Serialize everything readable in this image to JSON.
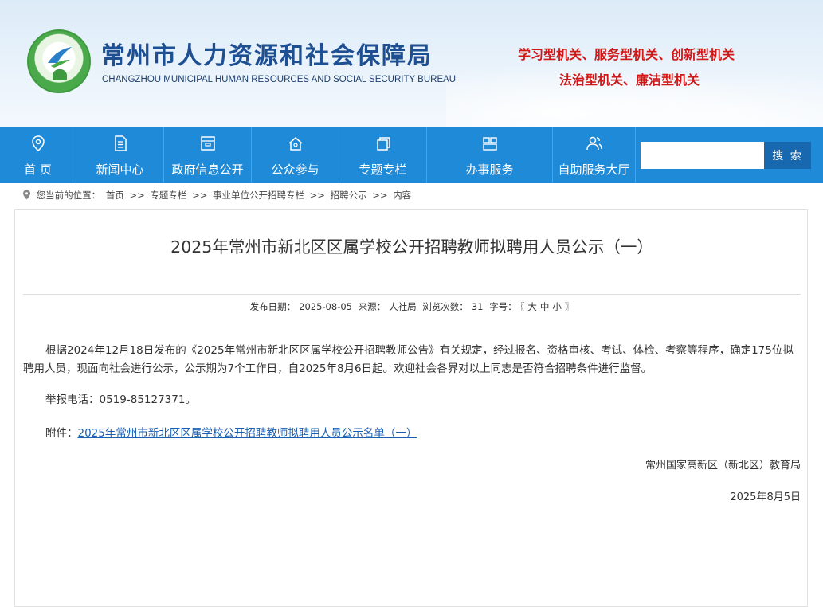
{
  "header": {
    "title_cn": "常州市人力资源和社会保障局",
    "title_en": "CHANGZHOU MUNICIPAL HUMAN RESOURCES AND SOCIAL SECURITY BUREAU",
    "slogan_line1": "学习型机关、服务型机关、创新型机关",
    "slogan_line2": "法治型机关、廉洁型机关",
    "logo_icon": "bureau-logo-icon",
    "slogan_color": "#d01818",
    "title_color": "#1d4f92"
  },
  "nav": {
    "bg_color": "#1f8ad8",
    "items": [
      {
        "label": "首 页",
        "icon": "location-pin-icon"
      },
      {
        "label": "新闻中心",
        "icon": "document-icon"
      },
      {
        "label": "政府信息公开",
        "icon": "archive-box-icon"
      },
      {
        "label": "公众参与",
        "icon": "people-home-icon"
      },
      {
        "label": "专题专栏",
        "icon": "stacked-pages-icon"
      },
      {
        "label": "办事服务",
        "icon": "service-icon"
      },
      {
        "label": "自助服务大厅",
        "icon": "users-icon"
      }
    ],
    "search_placeholder": "",
    "search_button": "搜 索"
  },
  "breadcrumb": {
    "prefix": "您当前的位置：",
    "items": [
      "首页",
      ">>",
      "专题专栏",
      ">>",
      "事业单位公开招聘专栏",
      ">>",
      "招聘公示",
      ">>",
      "内容"
    ]
  },
  "article": {
    "title": "2025年常州市新北区区属学校公开招聘教师拟聘用人员公示（一）",
    "meta": {
      "date_label": "发布日期：",
      "date": "2025-08-05",
      "source_label": "来源：",
      "source": "人社局",
      "views_label": "浏览次数：",
      "views": "31",
      "font_label": "字号：",
      "font_open": "〖",
      "font_large": "大",
      "font_medium": "中",
      "font_small": "小",
      "font_close": "〗"
    },
    "paragraph1": "根据2024年12月18日发布的《2025年常州市新北区区属学校公开招聘教师公告》有关规定，经过报名、资格审核、考试、体检、考察等程序，确定175位拟聘用人员，现面向社会进行公示，公示期为7个工作日，自2025年8月6日起。欢迎社会各界对以上同志是否符合招聘条件进行监督。",
    "report_phone": "举报电话：0519-85127371。",
    "attachment_label": "附件：",
    "attachment_link": "2025年常州市新北区区属学校公开招聘教师拟聘用人员公示名单（一）",
    "signature_org": "常州国家高新区（新北区）教育局",
    "signature_date": "2025年8月5日"
  }
}
